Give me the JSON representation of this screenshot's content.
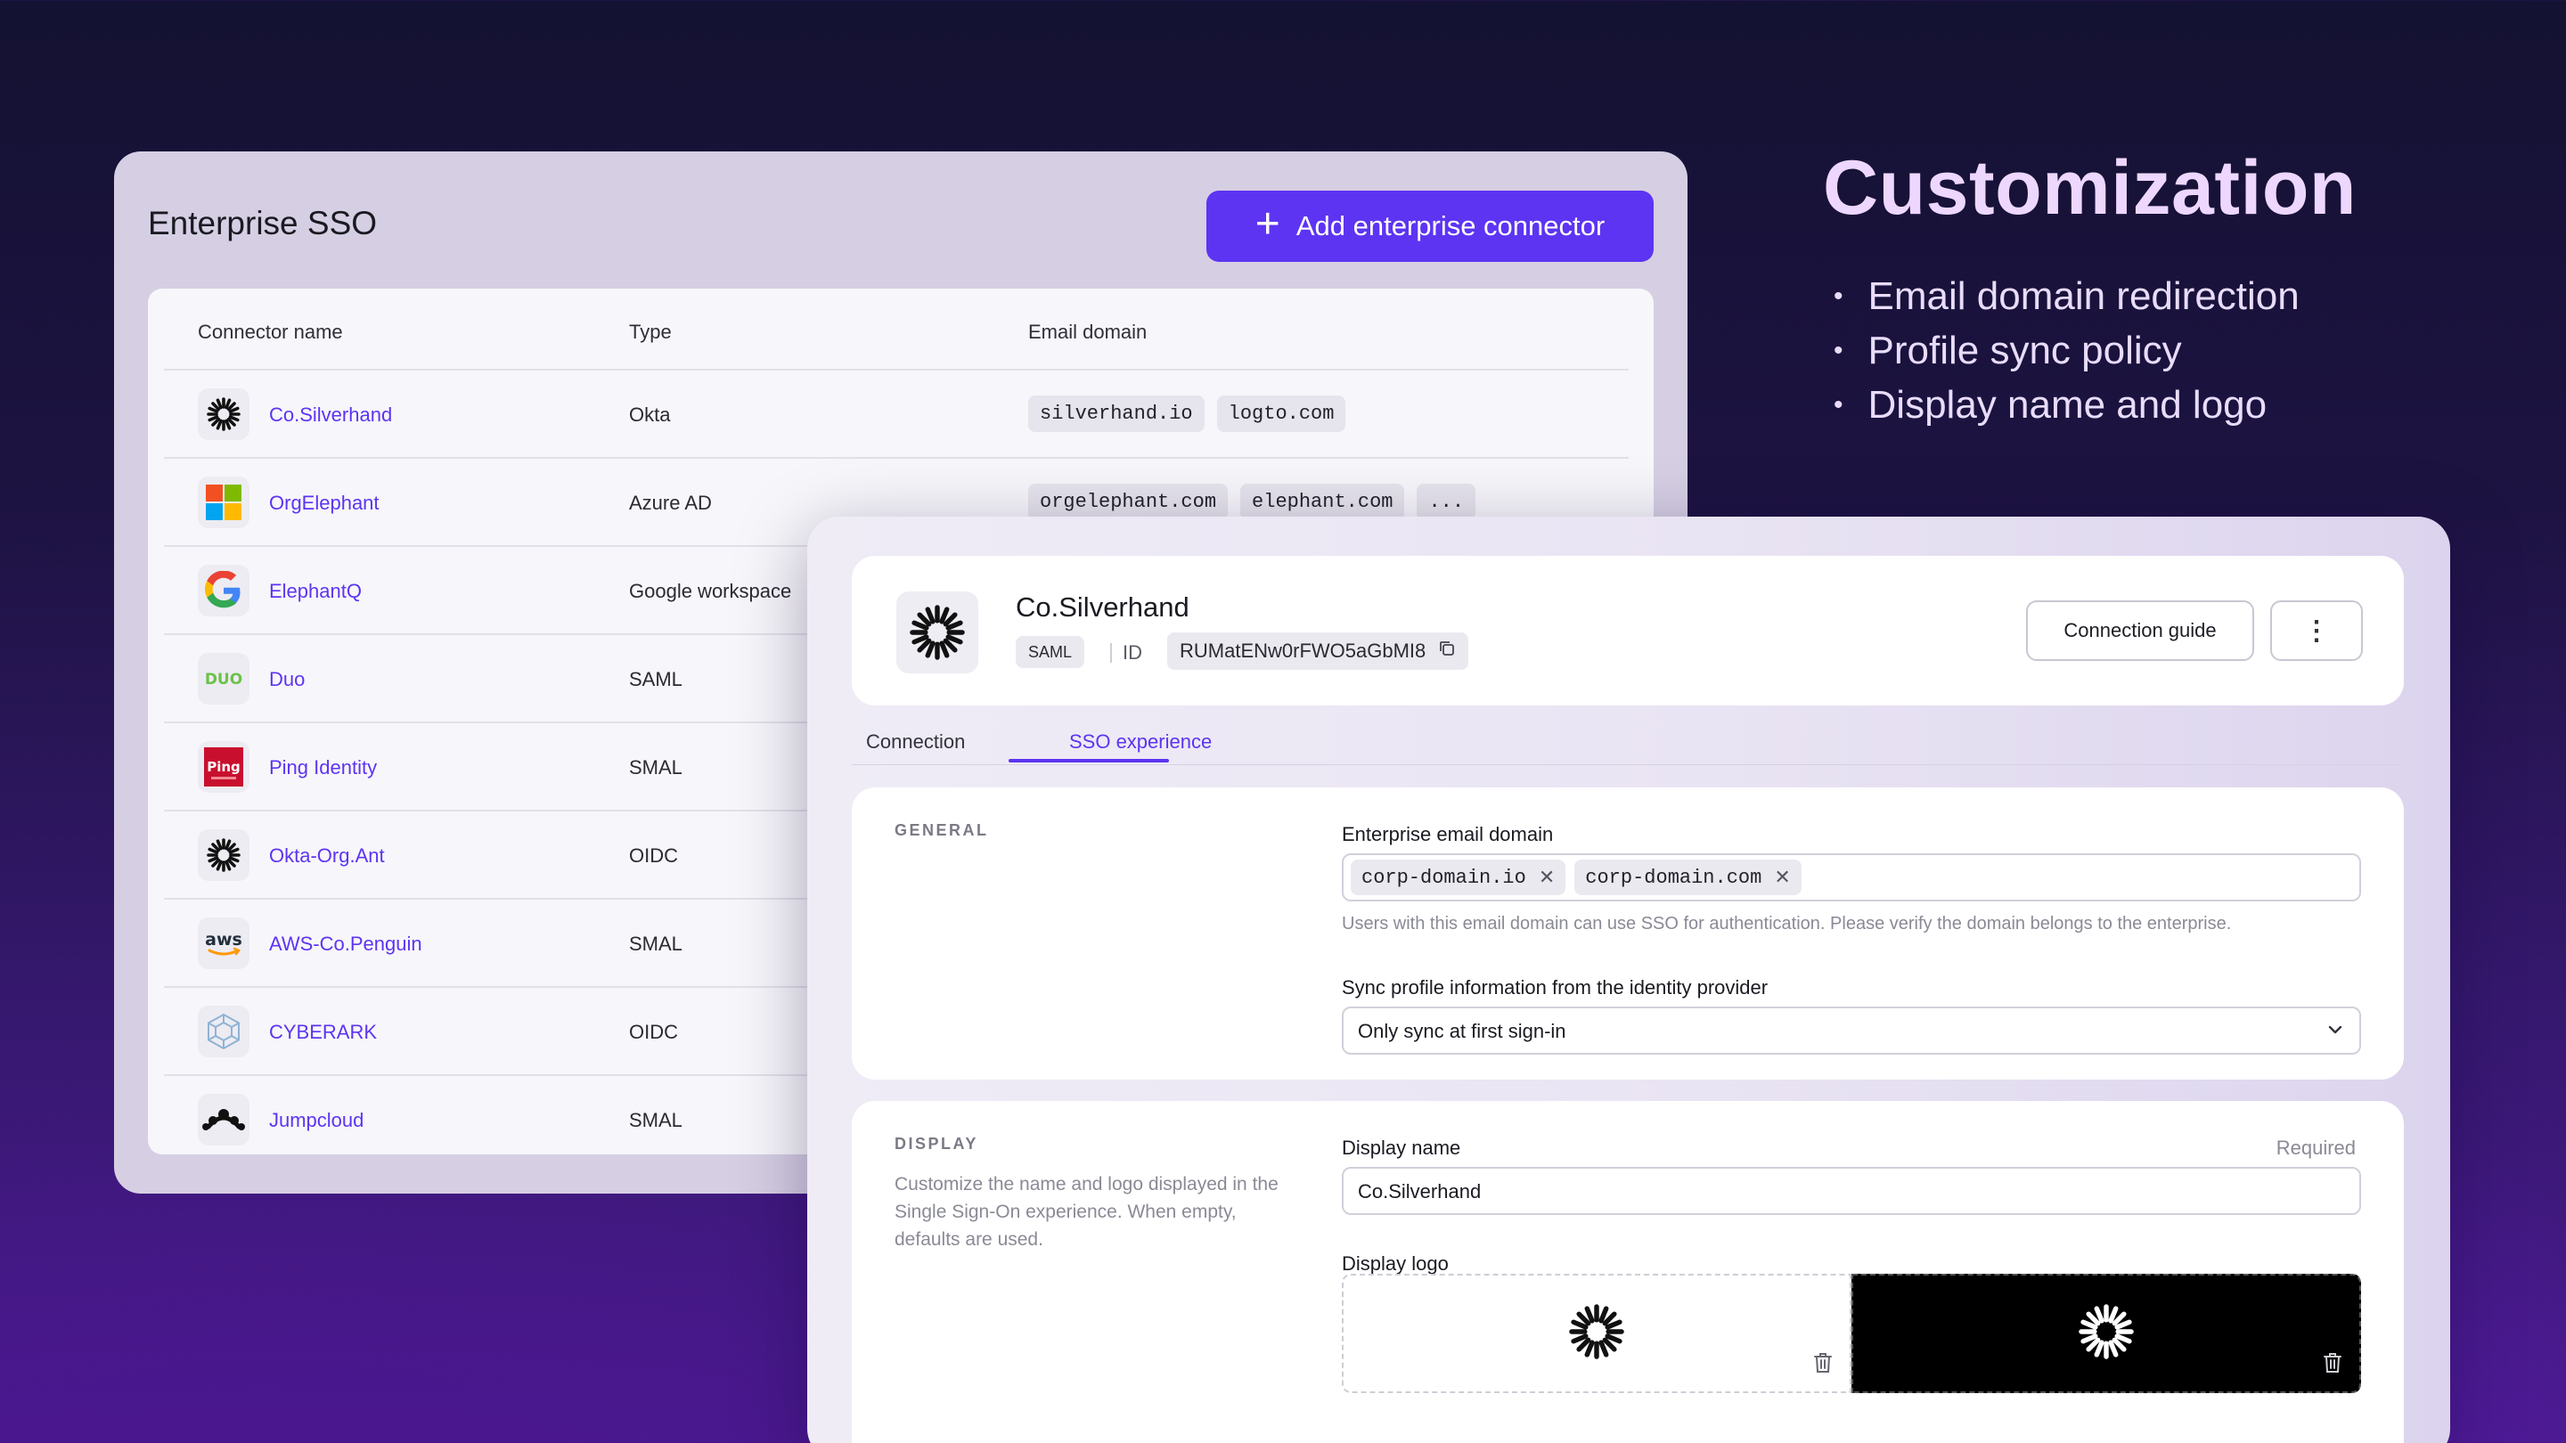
{
  "hero": {
    "title": "Customization",
    "bullets": [
      "Email domain redirection",
      "Profile sync policy",
      "Display name and logo"
    ]
  },
  "sso_list": {
    "title": "Enterprise SSO",
    "add_button": "Add enterprise connector",
    "columns": [
      "Connector name",
      "Type",
      "Email domain"
    ],
    "rows": [
      {
        "name": "Co.Silverhand",
        "type": "Okta",
        "icon": "okta-icon",
        "domains": [
          "silverhand.io",
          "logto.com"
        ],
        "more": ""
      },
      {
        "name": "OrgElephant",
        "type": "Azure AD",
        "icon": "microsoft-icon",
        "domains": [
          "orgelephant.com",
          "elephant.com"
        ],
        "more": "..."
      },
      {
        "name": "ElephantQ",
        "type": "Google workspace",
        "icon": "google-icon",
        "domains": [],
        "more": ""
      },
      {
        "name": "Duo",
        "type": "SAML",
        "icon": "duo-icon",
        "domains": [],
        "more": ""
      },
      {
        "name": "Ping Identity",
        "type": "SMAL",
        "icon": "ping-identity-icon",
        "domains": [],
        "more": ""
      },
      {
        "name": "Okta-Org.Ant",
        "type": "OIDC",
        "icon": "okta-icon",
        "domains": [],
        "more": ""
      },
      {
        "name": "AWS-Co.Penguin",
        "type": "SMAL",
        "icon": "aws-icon",
        "domains": [],
        "more": ""
      },
      {
        "name": "CYBERARK",
        "type": "OIDC",
        "icon": "cyberark-icon",
        "domains": [],
        "more": ""
      },
      {
        "name": "Jumpcloud",
        "type": "SMAL",
        "icon": "jumpcloud-icon",
        "domains": [],
        "more": ""
      }
    ]
  },
  "detail": {
    "name": "Co.Silverhand",
    "protocol": "SAML",
    "id_label": "ID",
    "id_value": "RUMatENw0rFWO5aGbMI8",
    "guide_button": "Connection guide",
    "more_button": "⋮",
    "tabs": [
      "Connection",
      "SSO experience"
    ],
    "active_tab": "SSO experience",
    "general": {
      "label": "GENERAL",
      "email_domain_label": "Enterprise email domain",
      "email_domains": [
        "corp-domain.io",
        "corp-domain.com"
      ],
      "email_domain_help": "Users with this email domain can use SSO for authentication. Please verify the domain belongs to the enterprise.",
      "sync_label": "Sync profile information from the identity provider",
      "sync_value": "Only sync at first sign-in"
    },
    "display": {
      "label": "DISPLAY",
      "description": "Customize the name and logo displayed in the Single Sign-On experience. When empty, defaults are used.",
      "name_label": "Display name",
      "required": "Required",
      "name_value": "Co.Silverhand",
      "logo_label": "Display logo"
    }
  },
  "colors": {
    "accent": "#5d34f2",
    "card_bg": "#d6cfe3",
    "hero_text": "#eed7ff"
  }
}
